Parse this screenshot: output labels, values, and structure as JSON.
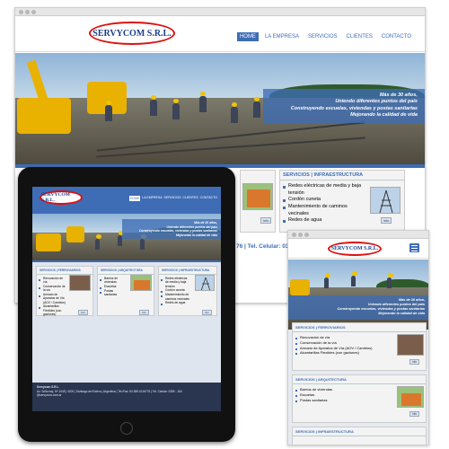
{
  "brand": {
    "logo_text": "SERVYCOM S.R.L."
  },
  "nav": [
    "HOME",
    "LA EMPRESA",
    "SERVICIOS",
    "CLIENTES",
    "CONTACTO"
  ],
  "hero": {
    "lines": [
      "Más de 30 años,",
      "Uniendo diferentes puntos del país",
      "Construyendo escuelas, viviendas y postas sanitarias",
      "Mejorando la calidad de vida"
    ]
  },
  "services": {
    "ferroviarios": {
      "title": "SERVICIOS | FERROVIARIOS",
      "items": [
        "Renovación de vía",
        "Conservación de la vía",
        "Armado de Aparatos de Vía (AOV / Cambios)",
        "Alcantarillas Flexibles (con gaviones)"
      ]
    },
    "arquitectura": {
      "title": "SERVICIOS | ARQUITECTURA",
      "items": [
        "Barrios de viviendas",
        "Escuelas",
        "Postas sanitarias"
      ]
    },
    "infraestructura": {
      "title": "SERVICIOS | INFRAESTRUCTURA",
      "items": [
        "Redes eléctricas de media y baja tensión",
        "Cordón cuneta",
        "Mantenimiento de caminos vecinales",
        "Redes de agua"
      ]
    }
  },
  "info_label": "info",
  "contact_strip": "76 | Tel. Celular: 0385 - 15",
  "tablet_footer": {
    "company": "Servycom S.R.L.",
    "address": "Av. Solís esq. Nº 1045 | 4200 | Santiago del Estero | Argentina | Tel./Fax: 54 385 4216776 | Tel. Celular: 0385 - 154",
    "email": "@servycom.com.ar"
  },
  "colors": {
    "accent": "#3e6db5",
    "logo_red": "#dd1111"
  }
}
